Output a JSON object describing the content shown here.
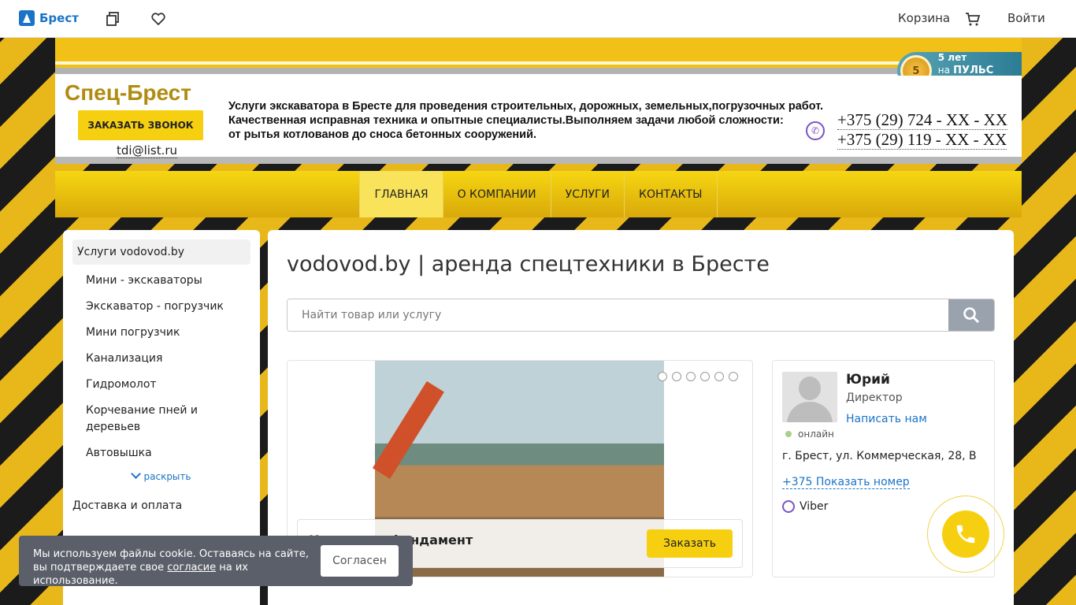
{
  "topbar": {
    "logo_text": "Брест",
    "cart_label": "Корзина",
    "login_label": "Войти"
  },
  "badge": {
    "coin": "5",
    "line1": "5 лет",
    "line2_prefix": "на",
    "line2_brand": "ПУЛЬС ЦЕН"
  },
  "header": {
    "brand": "Спец-Брест",
    "call_button": "ЗАКАЗАТЬ ЗВОНОК",
    "email": "tdi@list.ru",
    "description_line1": "Услуги экскаватора в Бресте для проведения строительных, дорожных, земельных,погрузочных работ.",
    "description_line2": "Качественная исправная техника и опытные специалисты.Выполняем задачи любой сложности:",
    "description_line3": "от рытья котлованов до сноса бетонных сооружений.",
    "phone1": "+375 (29) 724 - XX - XX",
    "phone2": "+375 (29) 119 - XX - XX"
  },
  "nav": {
    "items": [
      {
        "label": "ГЛАВНАЯ"
      },
      {
        "label": "О КОМПАНИИ"
      },
      {
        "label": "УСЛУГИ"
      },
      {
        "label": "КОНТАКТЫ"
      }
    ]
  },
  "sidebar": {
    "heading": "Услуги vodovod.by",
    "items": [
      {
        "label": "Мини - экскаваторы"
      },
      {
        "label": "Экскаватор - погрузчик"
      },
      {
        "label": "Мини погрузчик"
      },
      {
        "label": "Канализация"
      },
      {
        "label": "Гидромолот"
      },
      {
        "label": "Корчевание пней и деревьев"
      },
      {
        "label": "Автовышка"
      }
    ],
    "expand": "раскрыть",
    "bottom_link": "Доставка и оплата"
  },
  "main": {
    "title": "vodovod.by | аренда спецтехники в Бресте",
    "search_placeholder": "Найти товар или услугу",
    "slide_caption": "Копка под фундамент",
    "order_button": "Заказать"
  },
  "contact": {
    "name": "Юрий",
    "role": "Директор",
    "write_link": "Написать нам",
    "status": "онлайн",
    "address": "г. Брест, ул. Коммерческая, 28, В",
    "phone_link": "+375 Показать номер",
    "messenger": "Viber"
  },
  "cookie": {
    "text_before": "Мы используем файлы cookie. Оставаясь на сайте, вы подтверждаете свое",
    "link": "согласие",
    "text_after": "на их использование.",
    "button": "Согласен"
  },
  "colors": {
    "accent_yellow": "#f6d010",
    "link_blue": "#1a73c6",
    "brand_gold": "#b08c10"
  }
}
